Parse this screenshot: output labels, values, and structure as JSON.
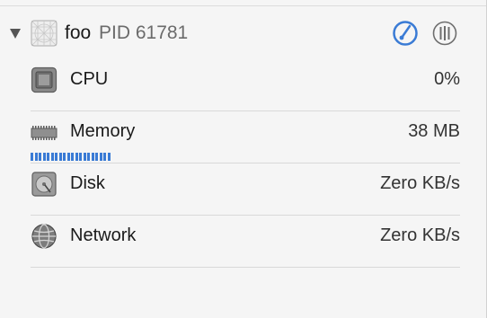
{
  "process": {
    "name": "foo",
    "pid_label": "PID 61781",
    "icons": {
      "disclosure": "disclosure-triangle-icon",
      "app": "generic-process-icon",
      "gauges": "debug-gauge-icon",
      "threads": "threads-icon"
    }
  },
  "gauges": [
    {
      "label": "CPU",
      "value": "0%",
      "icon": "cpu-chip-icon"
    },
    {
      "label": "Memory",
      "value": "38 MB",
      "icon": "memory-module-icon",
      "usage_fraction": 0.18
    },
    {
      "label": "Disk",
      "value": "Zero KB/s",
      "icon": "hard-disk-icon"
    },
    {
      "label": "Network",
      "value": "Zero KB/s",
      "icon": "network-globe-icon"
    }
  ],
  "colors": {
    "accent": "#3a7bd5",
    "background": "#f5f5f5",
    "divider": "#d9d9d9"
  }
}
